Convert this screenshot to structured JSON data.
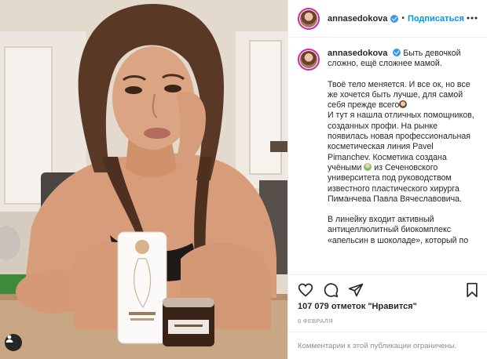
{
  "post": {
    "username": "annasedokova",
    "follow_label": "Подписаться",
    "separator": "•"
  },
  "caption": {
    "username": "annasedokova",
    "line1": "Быть девочкой сложно, ещё сложнее мамой.",
    "para2a": "Твоё тело меняется. И все ок, но все же хочется быть лучше, для самой себя прежде всего",
    "para2b": "И тут я нашла отличных помощников, созданных профи. На рынке появилась новая профессиональная косметическая линия Pavel Pimanchev. Косметика создана учёными",
    "para2c": "из Сеченовского университета под руководством известного пластического хирурга Пиманчева Павла Вячеславовича.",
    "para3": "В линейку входит активный антицеллюлитный биокомплекс «апельсин в шоколаде», который по"
  },
  "likes": {
    "count": "107 079",
    "word": "отметок",
    "quoted": "\"Нравится\""
  },
  "date": "6 ФЕВРАЛЯ",
  "comments_closed": "Комментарии к этой публикации ограничены.",
  "icons": {
    "verified": "verified-badge-icon",
    "more": "more-options-icon",
    "like": "heart-icon",
    "comment": "comment-icon",
    "share": "share-icon",
    "save": "bookmark-icon",
    "owner": "user-tag-icon"
  },
  "colors": {
    "accent": "#0095f6",
    "verified": "#3897f0",
    "text": "#262626",
    "muted": "#8e8e8e",
    "border": "#efefef"
  }
}
